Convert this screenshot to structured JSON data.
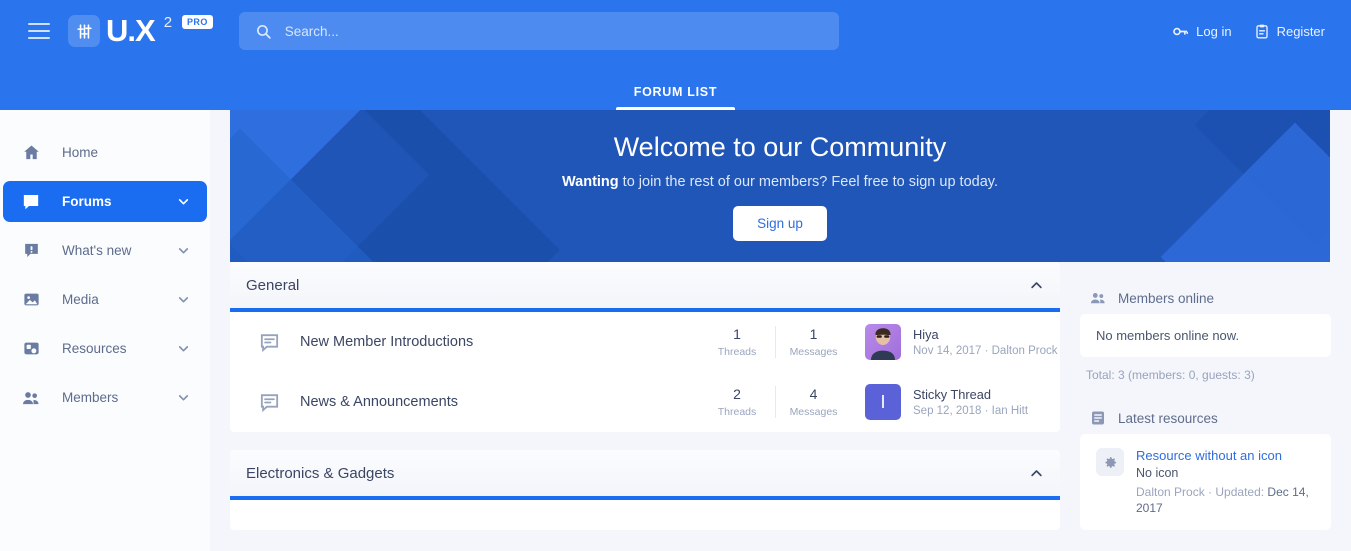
{
  "header": {
    "logo_text": "U.X",
    "logo_sup": "2",
    "logo_pro": "PRO",
    "search_placeholder": "Search...",
    "search_value": "",
    "login_label": "Log in",
    "register_label": "Register",
    "tabs": [
      {
        "label": "FORUM LIST",
        "active": true
      }
    ]
  },
  "sidebar": {
    "items": [
      {
        "label": "Home",
        "icon": "home-icon",
        "chevron": false,
        "active": false
      },
      {
        "label": "Forums",
        "icon": "forums-icon",
        "chevron": true,
        "active": true
      },
      {
        "label": "What's new",
        "icon": "whats-new-icon",
        "chevron": true,
        "active": false
      },
      {
        "label": "Media",
        "icon": "media-icon",
        "chevron": true,
        "active": false
      },
      {
        "label": "Resources",
        "icon": "resources-icon",
        "chevron": true,
        "active": false
      },
      {
        "label": "Members",
        "icon": "members-icon",
        "chevron": true,
        "active": false
      }
    ]
  },
  "banner": {
    "title": "Welcome to our Community",
    "subtitle_bold": "Wanting",
    "subtitle_rest": " to join the rest of our members? Feel free to sign up today.",
    "signup_label": "Sign up"
  },
  "forum_blocks": [
    {
      "title": "General",
      "collapsed": false,
      "rows": [
        {
          "name": "New Member Introductions",
          "threads": "1",
          "threads_label": "Threads",
          "messages": "1",
          "messages_label": "Messages",
          "avatar_type": "photo",
          "avatar_letter": "",
          "last_title": "Hiya",
          "last_sub": "Nov 14, 2017 · Dalton Prock"
        },
        {
          "name": "News & Announcements",
          "threads": "2",
          "threads_label": "Threads",
          "messages": "4",
          "messages_label": "Messages",
          "avatar_type": "letter",
          "avatar_letter": "I",
          "last_title": "Sticky Thread",
          "last_sub": "Sep 12, 2018 · Ian Hitt"
        }
      ]
    },
    {
      "title": "Electronics & Gadgets",
      "collapsed": false,
      "rows": []
    }
  ],
  "widgets": {
    "members_online": {
      "title": "Members online",
      "icon": "members-icon",
      "empty_text": "No members online now.",
      "total_text": "Total: 3 (members: 0, guests: 3)"
    },
    "latest_resources": {
      "title": "Latest resources",
      "icon": "document-icon",
      "items": [
        {
          "title": "Resource without an icon",
          "description": "No icon",
          "author": "Dalton Prock",
          "meta_separator": " · ",
          "updated_label": "Updated: ",
          "updated_date": "Dec 14, 2017"
        }
      ]
    }
  },
  "colors": {
    "header_blue": "#2a74ed",
    "banner_blue": "#1f56b8",
    "accent_blue": "#1a6cf0",
    "page_bg": "#f4f6fb",
    "link_blue": "#2f6ede"
  }
}
